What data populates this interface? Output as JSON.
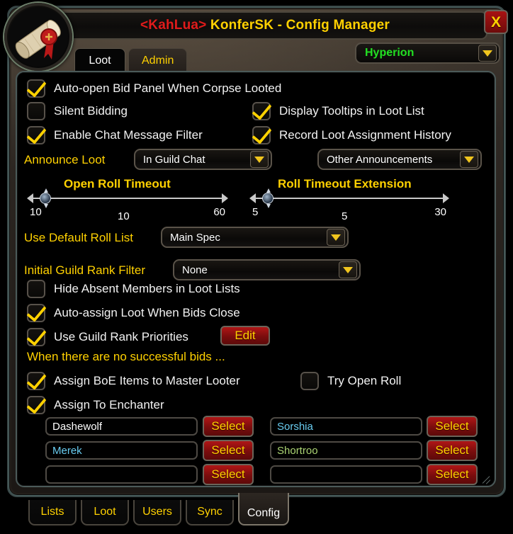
{
  "window": {
    "title_guild": "<KahLua>",
    "title_rest": " KonferSK - Config Manager",
    "close_label": "X",
    "logo_icon": "scroll-seal-icon"
  },
  "top_tabs": [
    {
      "label": "Loot",
      "active": true
    },
    {
      "label": "Admin",
      "active": false
    }
  ],
  "config_selector": {
    "value": "Hyperion",
    "arrow_icon": "chevron-down-icon"
  },
  "options": {
    "auto_open_bid_panel": {
      "label": "Auto-open Bid Panel When Corpse Looted",
      "checked": true
    },
    "silent_bidding": {
      "label": "Silent Bidding",
      "checked": false
    },
    "display_tooltips": {
      "label": "Display Tooltips in Loot List",
      "checked": true
    },
    "enable_chat_filter": {
      "label": "Enable Chat Message Filter",
      "checked": true
    },
    "record_history": {
      "label": "Record Loot Assignment History",
      "checked": true
    },
    "hide_absent": {
      "label": "Hide Absent Members in Loot Lists",
      "checked": false
    },
    "auto_assign": {
      "label": "Auto-assign Loot When Bids Close",
      "checked": true
    },
    "use_rank_priorities": {
      "label": "Use Guild Rank Priorities",
      "checked": true
    },
    "assign_boe": {
      "label": "Assign BoE Items to Master Looter",
      "checked": true
    },
    "try_open_roll": {
      "label": "Try Open Roll",
      "checked": false
    },
    "assign_enchanter": {
      "label": "Assign To Enchanter",
      "checked": true
    }
  },
  "announce": {
    "label": "Announce Loot",
    "where_value": "In Guild Chat",
    "other_value": "Other Announcements"
  },
  "sliders": [
    {
      "title": "Open Roll Timeout",
      "min": "10",
      "max": "60",
      "value": "10",
      "percent": 0
    },
    {
      "title": "Roll Timeout Extension",
      "min": "5",
      "max": "30",
      "value": "5",
      "percent": 0
    }
  ],
  "roll_list": {
    "label": "Use Default Roll List",
    "value": "Main Spec"
  },
  "rank_filter": {
    "label": "Initial Guild Rank Filter",
    "value": "None"
  },
  "edit_button": {
    "label": "Edit"
  },
  "no_bids_note": "When there are no successful bids ...",
  "enchanters": {
    "select_label": "Select",
    "left": [
      {
        "name": "Dashewolf",
        "color": "#ffffff"
      },
      {
        "name": "Merek",
        "color": "#69ccf0"
      },
      {
        "name": "",
        "color": "#ffffff"
      }
    ],
    "right": [
      {
        "name": "Sorshia",
        "color": "#69ccf0"
      },
      {
        "name": "Shortroo",
        "color": "#abd473"
      },
      {
        "name": "",
        "color": "#ffffff"
      }
    ]
  },
  "bottom_tabs": [
    {
      "label": "Lists",
      "active": false
    },
    {
      "label": "Loot",
      "active": false
    },
    {
      "label": "Users",
      "active": false
    },
    {
      "label": "Sync",
      "active": false
    },
    {
      "label": "Config",
      "active": true
    }
  ],
  "colors": {
    "gold": "#ffd100",
    "red": "#e01b1b",
    "green": "#22e022"
  }
}
